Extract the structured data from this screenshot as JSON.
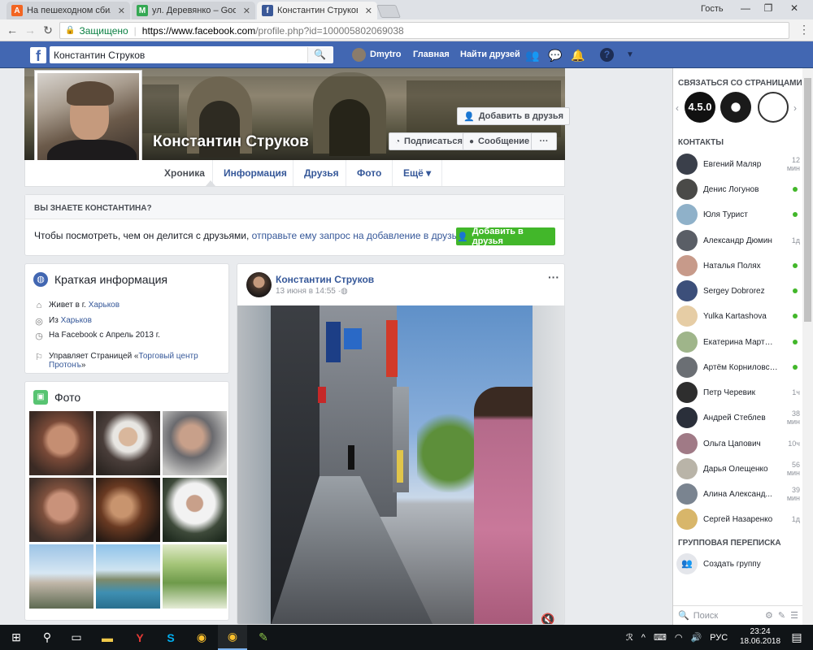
{
  "browser": {
    "tabs": [
      {
        "title": "На пешеходном сбила м",
        "favicon": "A",
        "favicon_color": "#f26522"
      },
      {
        "title": "ул. Деревянко – Google",
        "favicon": "M",
        "favicon_color": "#34a853"
      },
      {
        "title": "Константин Струков",
        "favicon": "f",
        "favicon_color": "#3b5998"
      }
    ],
    "user_label": "Гость",
    "secure_label": "Защищено",
    "url_host": "https://www.facebook.com",
    "url_rest": "/profile.php?id=100005802069038"
  },
  "fb": {
    "search_value": "Константин Струков",
    "me_name": "Dmytro",
    "nav": {
      "home": "Главная",
      "find_friends": "Найти друзей"
    }
  },
  "profile": {
    "name": "Константин Струков",
    "add_friend": "Добавить в друзья",
    "subscribe": "Подписаться",
    "message": "Сообщение",
    "more": "···",
    "tabs": [
      "Хроника",
      "Информация",
      "Друзья",
      "Фото",
      "Ещё ▾"
    ]
  },
  "know": {
    "heading": "ВЫ ЗНАЕТЕ КОНСТАНТИНА?",
    "text": "Чтобы посмотреть, чем он делится с друзьями,",
    "link": "отправьте ему запрос на добавление в друзья",
    "button": "Добавить в друзья"
  },
  "intro": {
    "heading": "Краткая информация",
    "lives_prefix": "Живет в г.",
    "lives_link": "Харьков",
    "from_prefix": "Из",
    "from_link": "Харьков",
    "since": "На Facebook с Апрель 2013 г.",
    "manages_prefix": "Управляет Страницей «",
    "manages_link": "Торговый центр Протонъ",
    "manages_suffix": "»"
  },
  "photos": {
    "heading": "Фото"
  },
  "post": {
    "author": "Константин Струков",
    "date": "13 июня в 14:55",
    "more": "···"
  },
  "sidebar": {
    "pages_heading": "СВЯЗАТЬСЯ СО СТРАНИЦАМИ",
    "page_badges": [
      "4.5.0",
      "",
      ""
    ],
    "contacts_heading": "КОНТАКТЫ",
    "contacts": [
      {
        "name": "Евгений Маляр",
        "status": "12 мин",
        "online": false,
        "color": "#3a3f4a"
      },
      {
        "name": "Денис Логунов",
        "status": "",
        "online": true,
        "color": "#4a4a48"
      },
      {
        "name": "Юля Турист",
        "status": "",
        "online": true,
        "color": "#8fb1c9"
      },
      {
        "name": "Александр Дюмин",
        "status": "1д",
        "online": false,
        "color": "#5a5e66"
      },
      {
        "name": "Наталья Полях",
        "status": "",
        "online": true,
        "color": "#c79a8a"
      },
      {
        "name": "Sergey Dobrorez",
        "status": "",
        "online": true,
        "color": "#3c4f7a"
      },
      {
        "name": "Yulka Kartashova",
        "status": "",
        "online": true,
        "color": "#e6cda5"
      },
      {
        "name": "Екатерина Мартынова",
        "status": "",
        "online": true,
        "color": "#9fb58a"
      },
      {
        "name": "Артём Корниловский",
        "status": "",
        "online": true,
        "color": "#6b6f74"
      },
      {
        "name": "Петр Черевик",
        "status": "1ч",
        "online": false,
        "color": "#2e2e2e"
      },
      {
        "name": "Андрей Стеблев",
        "status": "38 мин",
        "online": false,
        "color": "#2a2f3a"
      },
      {
        "name": "Ольга Цапович",
        "status": "10ч",
        "online": false,
        "color": "#a07a86"
      },
      {
        "name": "Дарья Олещенко",
        "status": "56 мин",
        "online": false,
        "color": "#b9b4a8"
      },
      {
        "name": "Алина Александ...",
        "status": "39 мин",
        "online": false,
        "color": "#7a8490"
      },
      {
        "name": "Сергей Назаренко",
        "status": "1д",
        "online": false,
        "color": "#d8b66a"
      }
    ],
    "group_heading": "ГРУППОВАЯ ПЕРЕПИСКА",
    "group_create": "Создать группу",
    "search_placeholder": "Поиск"
  },
  "taskbar": {
    "lang": "РУС",
    "time": "23:24",
    "date": "18.06.2018"
  }
}
